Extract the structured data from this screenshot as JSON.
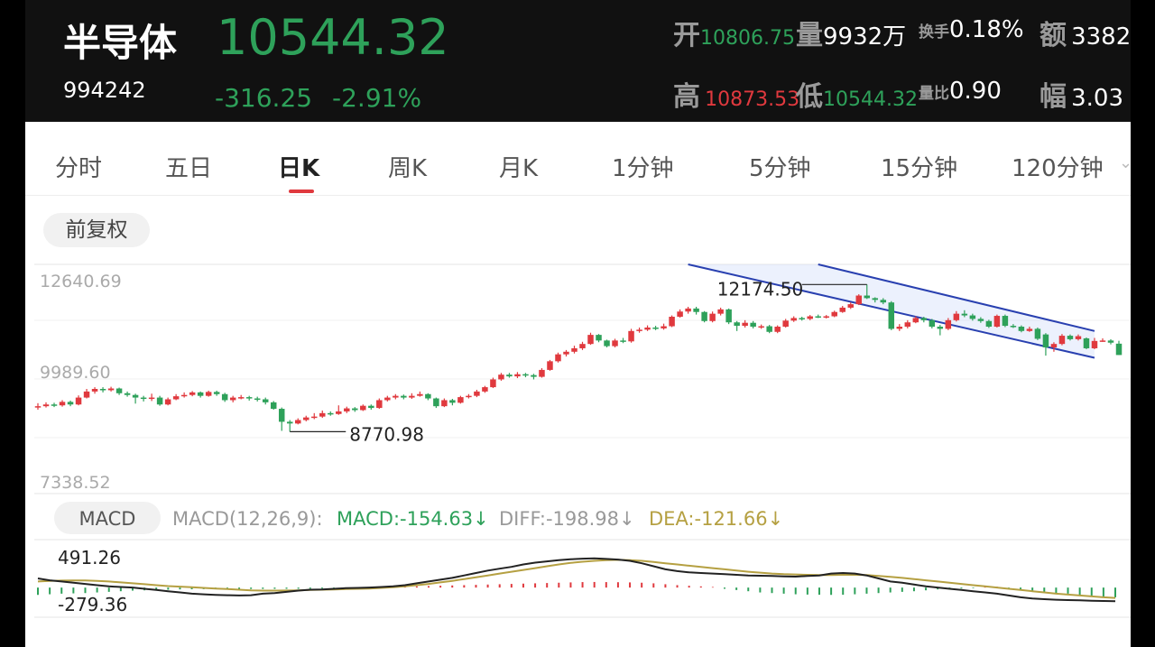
{
  "header": {
    "name": "半导体",
    "code": "994242",
    "price": "10544.32",
    "change": "-316.25",
    "change_pct": "-2.91%",
    "stats": {
      "open_label": "开",
      "open": "10806.75",
      "volume_label": "量",
      "volume": "9932万",
      "turnover_label": "换手",
      "turnover": "0.18%",
      "amount_label": "额",
      "amount": "3382",
      "high_label": "高",
      "high": "10873.53",
      "low_label": "低",
      "low": "10544.32",
      "vol_ratio_label": "量比",
      "vol_ratio": "0.90",
      "amplitude_label": "幅",
      "amplitude": "3.03"
    }
  },
  "tabs": [
    "分时",
    "五日",
    "日K",
    "周K",
    "月K",
    "1分钟",
    "5分钟",
    "15分钟",
    "120分钟"
  ],
  "active_tab": "日K",
  "adjust_button": "前复权",
  "colors": {
    "up": "#e0393e",
    "down": "#2ea15a",
    "channel": "#2940b0",
    "dea": "#b5a042",
    "diff": "#222222",
    "bg_header": "#111111"
  },
  "chart_data": [
    {
      "type": "candlestick",
      "y_ticks": [
        "12640.69",
        "9989.60",
        "7338.52"
      ],
      "ylim": [
        7338.52,
        12640.69
      ],
      "annotations": [
        {
          "label": "12174.50",
          "value": 12174.5,
          "kind": "high"
        },
        {
          "label": "8770.98",
          "value": 8770.98,
          "kind": "low"
        }
      ],
      "candles": [
        [
          9340,
          9360,
          9430,
          9280
        ],
        [
          9360,
          9400,
          9450,
          9330
        ],
        [
          9400,
          9380,
          9440,
          9340
        ],
        [
          9380,
          9460,
          9500,
          9350
        ],
        [
          9460,
          9400,
          9490,
          9360
        ],
        [
          9400,
          9560,
          9610,
          9380
        ],
        [
          9560,
          9700,
          9760,
          9540
        ],
        [
          9700,
          9760,
          9800,
          9650
        ],
        [
          9760,
          9730,
          9800,
          9680
        ],
        [
          9730,
          9770,
          9810,
          9700
        ],
        [
          9770,
          9660,
          9790,
          9620
        ],
        [
          9660,
          9620,
          9700,
          9580
        ],
        [
          9620,
          9560,
          9650,
          9420
        ],
        [
          9560,
          9530,
          9600,
          9470
        ],
        [
          9530,
          9560,
          9650,
          9480
        ],
        [
          9560,
          9400,
          9600,
          9370
        ],
        [
          9400,
          9520,
          9560,
          9380
        ],
        [
          9520,
          9590,
          9640,
          9500
        ],
        [
          9590,
          9620,
          9680,
          9560
        ],
        [
          9620,
          9680,
          9710,
          9590
        ],
        [
          9680,
          9600,
          9700,
          9560
        ],
        [
          9600,
          9690,
          9720,
          9580
        ],
        [
          9690,
          9640,
          9720,
          9600
        ],
        [
          9640,
          9500,
          9670,
          9460
        ],
        [
          9500,
          9560,
          9600,
          9450
        ],
        [
          9560,
          9570,
          9620,
          9520
        ],
        [
          9570,
          9540,
          9600,
          9490
        ],
        [
          9540,
          9520,
          9580,
          9470
        ],
        [
          9520,
          9450,
          9560,
          9400
        ],
        [
          9450,
          9300,
          9480,
          9280
        ],
        [
          9300,
          9000,
          9330,
          8790
        ],
        [
          9000,
          8960,
          9040,
          8771
        ],
        [
          8960,
          9040,
          9080,
          8940
        ],
        [
          9040,
          9100,
          9140,
          9010
        ],
        [
          9100,
          9120,
          9200,
          9060
        ],
        [
          9120,
          9200,
          9260,
          9090
        ],
        [
          9200,
          9180,
          9240,
          9140
        ],
        [
          9180,
          9240,
          9380,
          9160
        ],
        [
          9240,
          9310,
          9350,
          9200
        ],
        [
          9310,
          9270,
          9340,
          9230
        ],
        [
          9270,
          9370,
          9400,
          9250
        ],
        [
          9370,
          9320,
          9400,
          9280
        ],
        [
          9320,
          9500,
          9540,
          9300
        ],
        [
          9500,
          9560,
          9600,
          9470
        ],
        [
          9560,
          9600,
          9640,
          9520
        ],
        [
          9600,
          9560,
          9630,
          9520
        ],
        [
          9560,
          9600,
          9660,
          9530
        ],
        [
          9600,
          9640,
          9700,
          9580
        ],
        [
          9640,
          9540,
          9660,
          9500
        ],
        [
          9540,
          9360,
          9560,
          9320
        ],
        [
          9360,
          9500,
          9540,
          9340
        ],
        [
          9500,
          9440,
          9530,
          9380
        ],
        [
          9440,
          9570,
          9600,
          9420
        ],
        [
          9570,
          9600,
          9640,
          9540
        ],
        [
          9600,
          9700,
          9740,
          9570
        ],
        [
          9700,
          9800,
          9830,
          9670
        ],
        [
          9800,
          9980,
          10020,
          9780
        ],
        [
          9980,
          10090,
          10130,
          9950
        ],
        [
          10090,
          10050,
          10130,
          10020
        ],
        [
          10050,
          10100,
          10150,
          10010
        ],
        [
          10100,
          10080,
          10130,
          10030
        ],
        [
          10080,
          10040,
          10110,
          9980
        ],
        [
          10040,
          10200,
          10240,
          10020
        ],
        [
          10200,
          10400,
          10430,
          10180
        ],
        [
          10400,
          10560,
          10600,
          10370
        ],
        [
          10560,
          10620,
          10660,
          10510
        ],
        [
          10620,
          10700,
          10760,
          10580
        ],
        [
          10700,
          10800,
          10850,
          10660
        ],
        [
          10800,
          11010,
          11060,
          10780
        ],
        [
          11010,
          10880,
          11030,
          10840
        ],
        [
          10880,
          10750,
          10900,
          10720
        ],
        [
          10750,
          10880,
          10920,
          10720
        ],
        [
          10880,
          10860,
          10940,
          10820
        ],
        [
          10860,
          11100,
          11150,
          10830
        ],
        [
          11100,
          11130,
          11180,
          11060
        ],
        [
          11130,
          11180,
          11230,
          11100
        ],
        [
          11180,
          11160,
          11220,
          11120
        ],
        [
          11160,
          11210,
          11270,
          11130
        ],
        [
          11210,
          11430,
          11460,
          11190
        ],
        [
          11430,
          11550,
          11600,
          11410
        ],
        [
          11550,
          11620,
          11660,
          11500
        ],
        [
          11620,
          11540,
          11660,
          11480
        ],
        [
          11540,
          11330,
          11560,
          11300
        ],
        [
          11330,
          11500,
          11550,
          11300
        ],
        [
          11500,
          11600,
          11640,
          11460
        ],
        [
          11600,
          11300,
          11620,
          11260
        ],
        [
          11300,
          11220,
          11330,
          11100
        ],
        [
          11220,
          11290,
          11350,
          11180
        ],
        [
          11290,
          11200,
          11330,
          11160
        ],
        [
          11200,
          11210,
          11250,
          11150
        ],
        [
          11210,
          11080,
          11240,
          11050
        ],
        [
          11080,
          11200,
          11230,
          11050
        ],
        [
          11200,
          11340,
          11380,
          11180
        ],
        [
          11340,
          11400,
          11440,
          11310
        ],
        [
          11400,
          11380,
          11430,
          11340
        ],
        [
          11380,
          11440,
          11470,
          11350
        ],
        [
          11440,
          11420,
          11480,
          11400
        ],
        [
          11420,
          11440,
          11470,
          11390
        ],
        [
          11440,
          11540,
          11570,
          11420
        ],
        [
          11540,
          11640,
          11680,
          11520
        ],
        [
          11640,
          11720,
          11760,
          11610
        ],
        [
          11720,
          11920,
          11950,
          11700
        ],
        [
          11920,
          11860,
          12174.5,
          11840
        ],
        [
          11860,
          11820,
          11880,
          11760
        ],
        [
          11820,
          11760,
          11860,
          11720
        ],
        [
          11760,
          11150,
          11790,
          11120
        ],
        [
          11150,
          11200,
          11260,
          11100
        ],
        [
          11200,
          11300,
          11350,
          11160
        ],
        [
          11300,
          11400,
          11440,
          11280
        ],
        [
          11400,
          11350,
          11430,
          11300
        ],
        [
          11350,
          11200,
          11380,
          11160
        ],
        [
          11200,
          11150,
          11240,
          11000
        ],
        [
          11150,
          11350,
          11400,
          11120
        ],
        [
          11350,
          11500,
          11560,
          11320
        ],
        [
          11500,
          11460,
          11580,
          11420
        ],
        [
          11460,
          11380,
          11500,
          11340
        ],
        [
          11380,
          11330,
          11420,
          11290
        ],
        [
          11330,
          11200,
          11360,
          11170
        ],
        [
          11200,
          11450,
          11480,
          11180
        ],
        [
          11450,
          11220,
          11480,
          11190
        ],
        [
          11220,
          11200,
          11260,
          11170
        ],
        [
          11200,
          11100,
          11230,
          11070
        ],
        [
          11100,
          11150,
          11200,
          11080
        ],
        [
          11150,
          10920,
          11180,
          10890
        ],
        [
          11020,
          10720,
          11050,
          10530
        ],
        [
          10720,
          10800,
          10840,
          10620
        ],
        [
          10800,
          10990,
          11030,
          10770
        ],
        [
          10990,
          10910,
          11020,
          10880
        ],
        [
          10910,
          10980,
          11020,
          10880
        ],
        [
          10930,
          10700,
          10950,
          10680
        ],
        [
          10700,
          10870,
          10940,
          10680
        ],
        [
          10870,
          10880,
          10930,
          10850
        ],
        [
          10880,
          10830,
          10910,
          10790
        ],
        [
          10806.75,
          10544.32,
          10873.53,
          10544.32
        ]
      ],
      "channel": {
        "upper": [
          [
            96,
            12640.69
          ],
          [
            130,
            11100
          ]
        ],
        "lower": [
          [
            80,
            12640.69
          ],
          [
            130,
            10480
          ]
        ]
      }
    },
    {
      "type": "macd",
      "title": "MACD",
      "params": "MACD(12,26,9):",
      "macd_label": "MACD:-154.63↓",
      "diff_label": "DIFF:-198.98↓",
      "dea_label": "DEA:-121.66↓",
      "y_ticks": [
        "491.26",
        "-279.36"
      ],
      "ylim": [
        -279.36,
        491.26
      ],
      "diff": [
        150,
        120,
        100,
        80,
        60,
        40,
        20,
        10,
        0,
        -20,
        -40,
        -60,
        -80,
        -100,
        -110,
        -120,
        -125,
        -130,
        -125,
        -100,
        -90,
        -70,
        -50,
        -35,
        -30,
        -20,
        -10,
        -5,
        0,
        10,
        20,
        40,
        70,
        100,
        130,
        160,
        200,
        240,
        280,
        310,
        340,
        380,
        410,
        430,
        450,
        465,
        475,
        480,
        470,
        460,
        440,
        400,
        350,
        300,
        270,
        250,
        240,
        230,
        220,
        210,
        200,
        195,
        190,
        185,
        180,
        190,
        200,
        230,
        240,
        230,
        200,
        150,
        100,
        80,
        50,
        20,
        0,
        -20,
        -40,
        -60,
        -80,
        -100,
        -130,
        -160,
        -180,
        -190,
        -200,
        -205,
        -210,
        -215,
        -220,
        -225
      ],
      "dea": [
        100,
        110,
        115,
        118,
        116,
        110,
        100,
        85,
        70,
        55,
        40,
        25,
        15,
        5,
        -5,
        -15,
        -25,
        -35,
        -45,
        -50,
        -50,
        -48,
        -45,
        -40,
        -35,
        -30,
        -25,
        -20,
        -15,
        -5,
        5,
        20,
        40,
        60,
        85,
        110,
        140,
        170,
        200,
        230,
        260,
        290,
        320,
        350,
        380,
        405,
        425,
        440,
        450,
        455,
        450,
        440,
        420,
        400,
        380,
        360,
        340,
        320,
        300,
        280,
        260,
        245,
        230,
        220,
        215,
        210,
        205,
        205,
        210,
        210,
        205,
        190,
        175,
        160,
        140,
        120,
        100,
        80,
        60,
        40,
        20,
        0,
        -20,
        -40,
        -60,
        -80,
        -100,
        -115,
        -130,
        -145,
        -160,
        -170
      ],
      "hist": [
        -120,
        -110,
        -100,
        -95,
        -90,
        -80,
        -70,
        -60,
        -50,
        -45,
        -40,
        -35,
        -30,
        -28,
        -26,
        -25,
        -25,
        -24,
        -23,
        -22,
        -21,
        -20,
        -20,
        -18,
        -16,
        -14,
        -12,
        -10,
        -8,
        -6,
        10,
        15,
        20,
        25,
        30,
        35,
        40,
        45,
        50,
        55,
        60,
        65,
        70,
        75,
        80,
        85,
        90,
        92,
        90,
        88,
        85,
        80,
        70,
        55,
        40,
        30,
        20,
        10,
        -20,
        -40,
        -60,
        -80,
        -90,
        -100,
        -110,
        -115,
        -118,
        -120,
        -118,
        -110,
        -100,
        -90,
        -80,
        -70,
        -60,
        -45,
        -30,
        -20,
        -15,
        -10,
        10,
        15,
        -20,
        -40,
        -60,
        -80,
        -90,
        -100,
        -120,
        -140,
        -150,
        -160
      ]
    }
  ]
}
